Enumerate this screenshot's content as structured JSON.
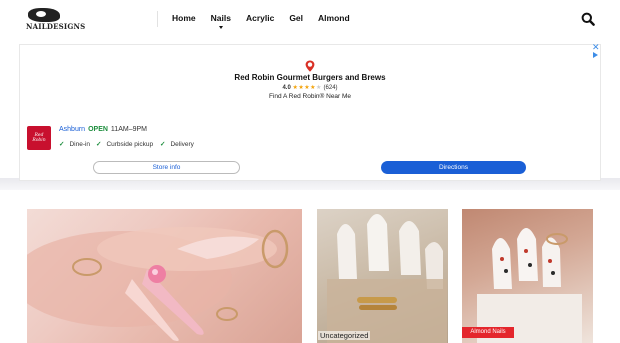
{
  "header": {
    "logo_text": "NAILDESIGNS",
    "nav": [
      {
        "label": "Home"
      },
      {
        "label": "Nails"
      },
      {
        "label": "Acrylic"
      },
      {
        "label": "Gel"
      },
      {
        "label": "Almond"
      }
    ]
  },
  "ad": {
    "title": "Red Robin Gourmet Burgers and Brews",
    "rating": "4.0",
    "review_count": "(624)",
    "subtitle": "Find A Red Robin® Near Me",
    "biz_logo_text": "Red Robin",
    "location": "Ashburn",
    "status": "OPEN",
    "hours": "11AM–9PM",
    "services": [
      "Dine-in",
      "Curbside pickup",
      "Delivery"
    ],
    "store_info_label": "Store info",
    "directions_label": "Directions",
    "close_glyph": "✕"
  },
  "cards": {
    "card2_category": "Uncategorized",
    "card3_tag": "Almond Nails"
  },
  "colors": {
    "accent_blue": "#1a5fd6",
    "open_green": "#1e8e3e",
    "brand_red": "#c8102e",
    "tag_red": "#e4262c"
  },
  "icons": [
    "search-icon",
    "location-pin-icon",
    "adchoices-icon",
    "close-icon",
    "check-icon",
    "caret-down-icon"
  ]
}
